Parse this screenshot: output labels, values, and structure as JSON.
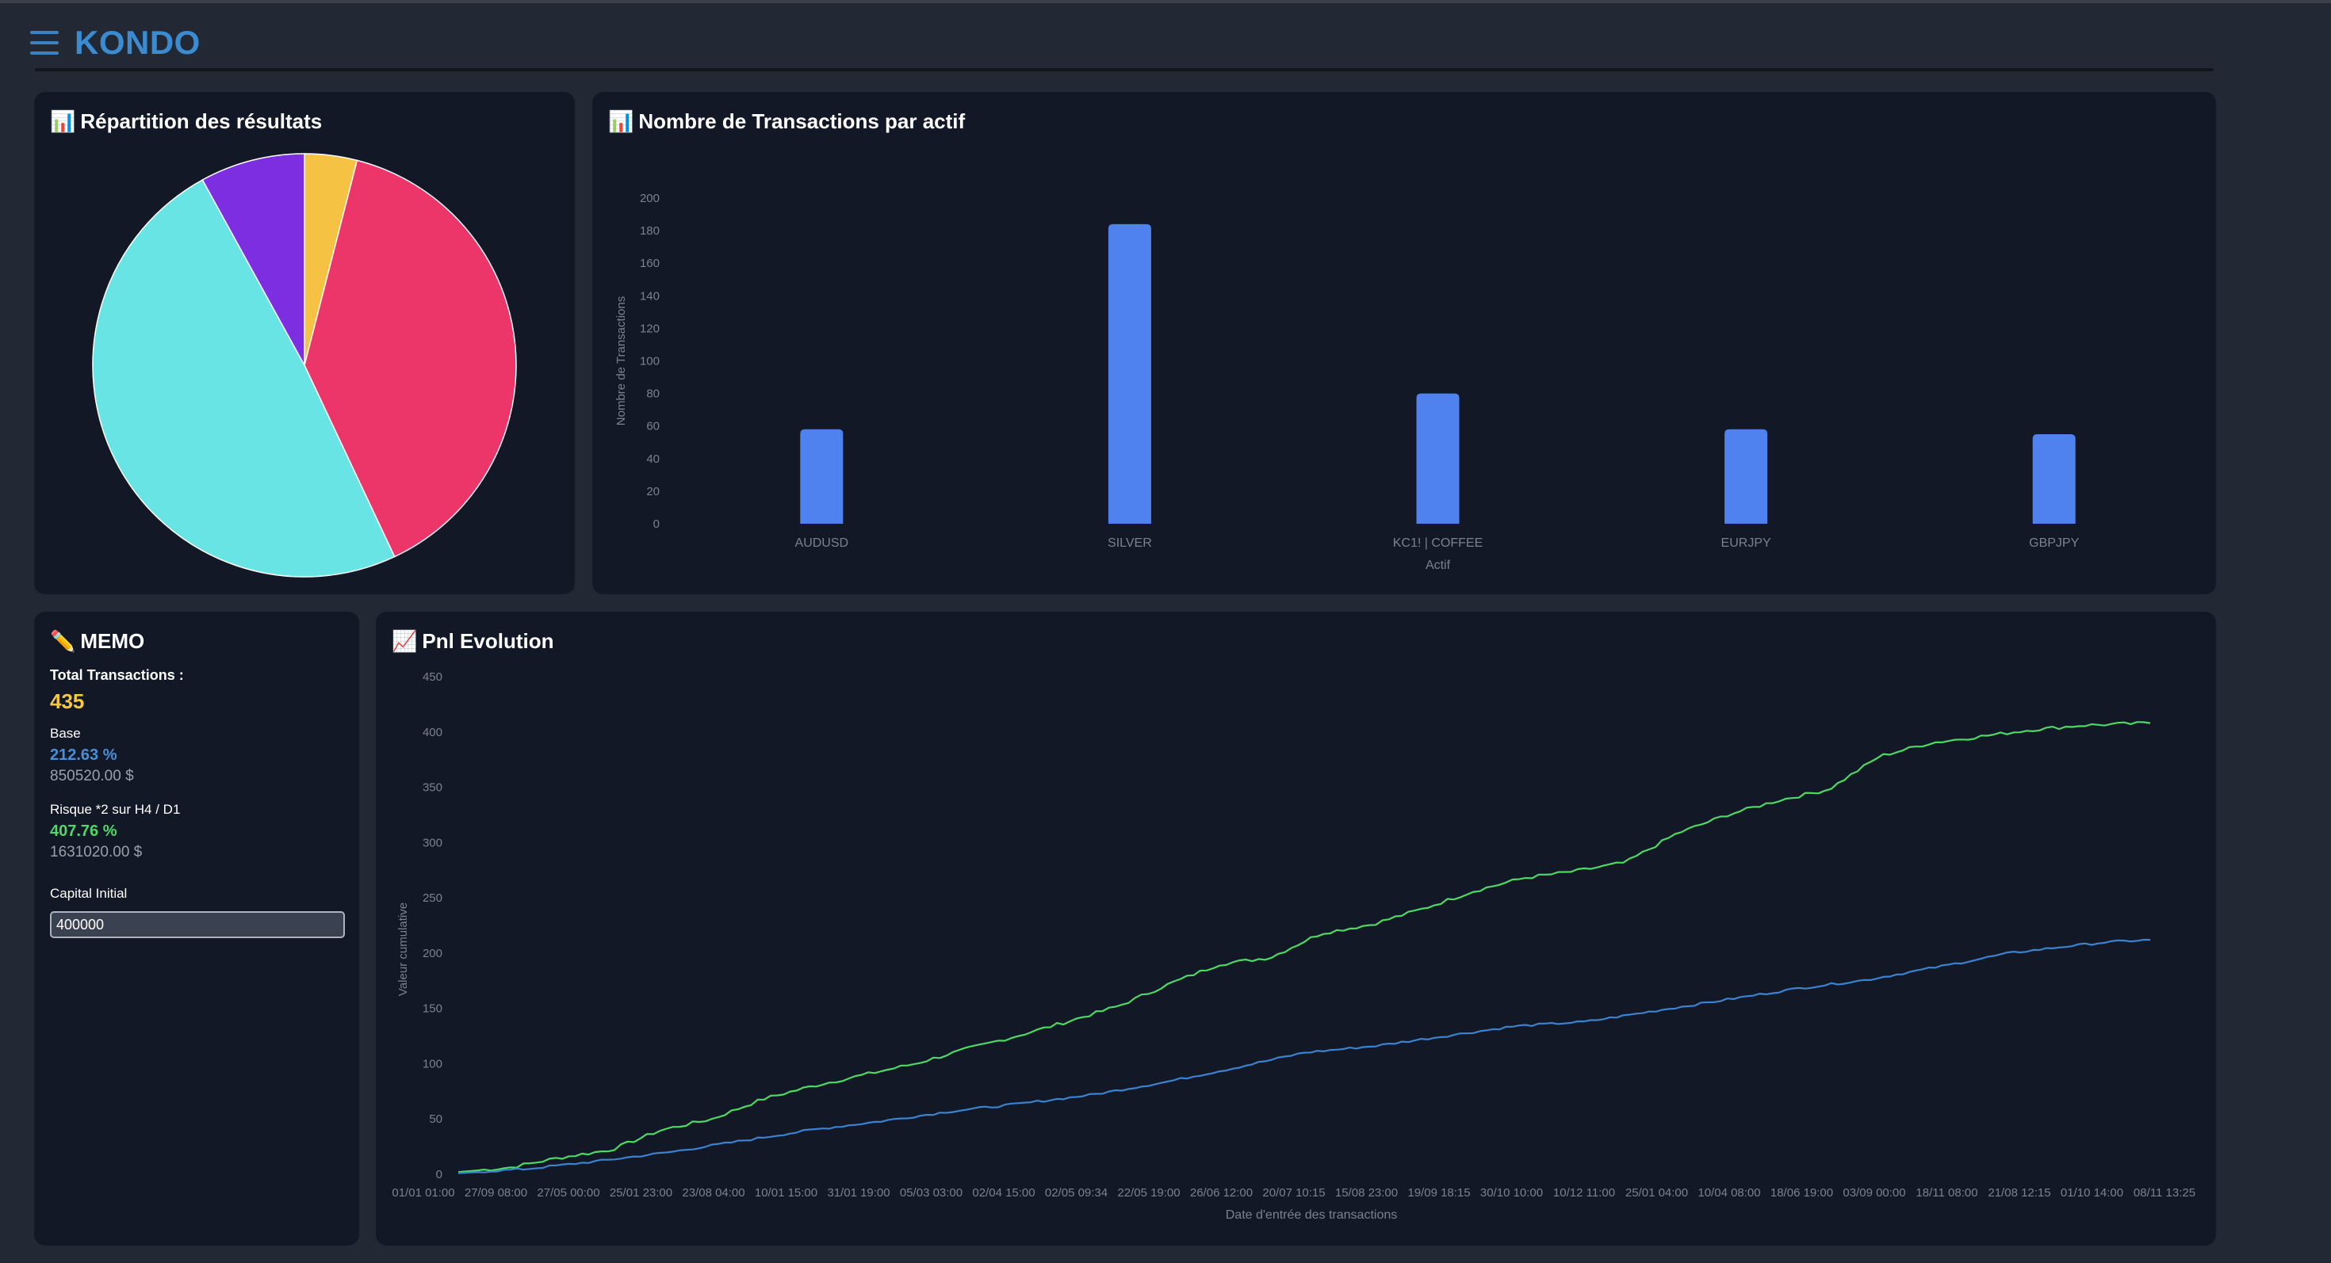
{
  "app": {
    "brand": "KONDO"
  },
  "pie_card": {
    "icon": "📊",
    "title": "Répartition des résultats",
    "chart_data": {
      "type": "pie",
      "slices": [
        {
          "value": 4,
          "color": "#f6c244"
        },
        {
          "value": 39,
          "color": "#ec3569"
        },
        {
          "value": 49,
          "color": "#68e4e4"
        },
        {
          "value": 8,
          "color": "#7d2ee0"
        }
      ]
    }
  },
  "bar_card": {
    "icon": "📊",
    "title": "Nombre de Transactions par actif",
    "chart_data": {
      "type": "bar",
      "categories": [
        "AUDUSD",
        "SILVER",
        "KC1! | COFFEE",
        "EURJPY",
        "GBPJPY"
      ],
      "values": [
        58,
        184,
        80,
        58,
        55
      ],
      "yticks": [
        0,
        20,
        40,
        60,
        80,
        100,
        120,
        140,
        160,
        180,
        200
      ],
      "ylim": [
        0,
        200
      ],
      "xlabel": "Actif",
      "ylabel": "Nombre de Transactions",
      "color": "#4f82ee"
    }
  },
  "memo": {
    "icon": "✏️",
    "title": "MEMO",
    "total_label": "Total Transactions :",
    "total_value": "435",
    "base_label": "Base",
    "base_pct": "212.63 %",
    "base_amount": "850520.00 $",
    "risk_label": "Risque *2 sur H4 / D1",
    "risk_pct": "407.76 %",
    "risk_amount": "1631020.00 $",
    "capital_label": "Capital Initial",
    "capital_value": "400000"
  },
  "pnl_card": {
    "icon": "📈",
    "title": "Pnl Evolution",
    "chart_data": {
      "type": "line",
      "x_ticks": [
        "01/01 01:00",
        "27/09 08:00",
        "27/05 00:00",
        "25/01 23:00",
        "23/08 04:00",
        "10/01 15:00",
        "31/01 19:00",
        "05/03 03:00",
        "02/04 15:00",
        "02/05 09:34",
        "22/05 19:00",
        "26/06 12:00",
        "20/07 10:15",
        "15/08 23:00",
        "19/09 18:15",
        "30/10 10:00",
        "10/12 11:00",
        "25/01 04:00",
        "10/04 08:00",
        "18/06 19:00",
        "03/09 00:00",
        "18/11 08:00",
        "21/08 12:15",
        "01/10 14:00",
        "08/11 13:25"
      ],
      "yticks": [
        0,
        50,
        100,
        150,
        200,
        250,
        300,
        350,
        400,
        450
      ],
      "ylim": [
        0,
        450
      ],
      "xlabel": "Date d'entrée des transactions",
      "ylabel": "Valeur cumulative",
      "series": [
        {
          "color": "#4cd964",
          "keypoints": [
            [
              0,
              2
            ],
            [
              3,
              6
            ],
            [
              6,
              15
            ],
            [
              9,
              22
            ],
            [
              12,
              40
            ],
            [
              15,
              50
            ],
            [
              18,
              68
            ],
            [
              21,
              80
            ],
            [
              24,
              90
            ],
            [
              27,
              100
            ],
            [
              30,
              113
            ],
            [
              33,
              125
            ],
            [
              36,
              138
            ],
            [
              39,
              152
            ],
            [
              42,
              172
            ],
            [
              45,
              190
            ],
            [
              48,
              196
            ],
            [
              51,
              218
            ],
            [
              54,
              226
            ],
            [
              57,
              240
            ],
            [
              60,
              256
            ],
            [
              63,
              268
            ],
            [
              66,
              274
            ],
            [
              69,
              282
            ],
            [
              72,
              308
            ],
            [
              75,
              325
            ],
            [
              78,
              338
            ],
            [
              81,
              348
            ],
            [
              84,
              378
            ],
            [
              87,
              390
            ],
            [
              90,
              396
            ],
            [
              93,
              402
            ],
            [
              96,
              406
            ],
            [
              100,
              408
            ]
          ]
        },
        {
          "color": "#3b82d0",
          "keypoints": [
            [
              0,
              1
            ],
            [
              5,
              5
            ],
            [
              10,
              12
            ],
            [
              15,
              20
            ],
            [
              20,
              30
            ],
            [
              25,
              40
            ],
            [
              30,
              48
            ],
            [
              35,
              57
            ],
            [
              40,
              64
            ],
            [
              45,
              72
            ],
            [
              50,
              83
            ],
            [
              55,
              96
            ],
            [
              60,
              110
            ],
            [
              65,
              116
            ],
            [
              70,
              125
            ],
            [
              75,
              134
            ],
            [
              80,
              138
            ],
            [
              85,
              148
            ],
            [
              90,
              158
            ],
            [
              95,
              168
            ],
            [
              100,
              176
            ],
            [
              103,
              183
            ],
            [
              106,
              190
            ],
            [
              110,
              200
            ],
            [
              114,
              206
            ],
            [
              117,
              210
            ],
            [
              120,
              212
            ]
          ]
        }
      ]
    }
  }
}
